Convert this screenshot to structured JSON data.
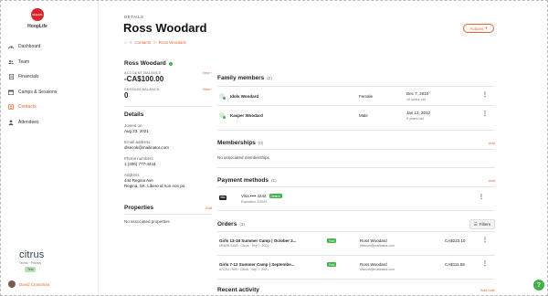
{
  "app": {
    "logo_text": "HoopLife",
    "logo_badge": "HoopLife"
  },
  "sidebar": {
    "items": [
      {
        "label": "Dashboard",
        "icon": "dashboard-icon"
      },
      {
        "label": "Team",
        "icon": "team-icon"
      },
      {
        "label": "Financials",
        "icon": "financials-icon"
      },
      {
        "label": "Camps & Sessions",
        "icon": "camps-icon"
      },
      {
        "label": "Contacts",
        "icon": "contacts-icon",
        "active": true
      },
      {
        "label": "Attendees",
        "icon": "attendees-icon"
      }
    ],
    "brand": "citrus",
    "footer_links": "Terms  ·  Privacy",
    "env_badge": "Test",
    "user_name": "David Crossman"
  },
  "header": {
    "section_label": "DETAILS",
    "title": "Ross Woodard",
    "breadcrumb": [
      "⌂",
      ">",
      "Contacts",
      ">",
      "Ross Woodard"
    ],
    "actions_label": "Actions"
  },
  "profile": {
    "name": "Ross Woodard",
    "account_balance_label": "ACCOUNT BALANCE",
    "account_balance_value": "-CA$100.00",
    "session_balance_label": "SESSION BALANCE",
    "session_balance_value": "0",
    "view_label": "View"
  },
  "details": {
    "title": "Details",
    "joined_label": "Joined on",
    "joined_value": "Aug 23, 2021",
    "email_label": "Email address",
    "email_value": "dlsecok@mailinator.com",
    "phone_label": "Phone numbers",
    "phone_value": "1 (306) 777-4444",
    "address_label": "Address",
    "address_line1": "444 Regina Ave",
    "address_line2": "Regina, SK. Libero id non non po"
  },
  "properties": {
    "title": "Properties",
    "edit_label": "Edit",
    "empty": "No associated properties"
  },
  "family": {
    "title": "Family members",
    "count": "(2)",
    "members": [
      {
        "name": "Idols Woodard",
        "gender": "Female",
        "dob": "Dec 7, 2010",
        "age": "10 years old"
      },
      {
        "name": "Kasper Woodard",
        "gender": "Male",
        "dob": "Jan 13, 2012",
        "age": "9 years old"
      }
    ]
  },
  "memberships": {
    "title": "Memberships",
    "count": "(0)",
    "add_label": "Add",
    "empty": "No associated memberships"
  },
  "payments": {
    "title": "Payment methods",
    "count": "(1)",
    "add_label": "Add",
    "card_brand": "VISA",
    "card_label": "Visa •••• 4242",
    "default_label": "Default",
    "expiry": "Expiration: 4/2024"
  },
  "orders": {
    "title": "Orders",
    "count": "(2)",
    "filters_label": "Filters",
    "items": [
      {
        "title": "Girls 13-18 Summer Camp | October 2...",
        "sub": "#R4BR-5163 · Citrus · Sep 7, 2021",
        "status": "Paid",
        "customer": "Ross Woodard",
        "email": "dlsecok@mailinator.com",
        "amount": "CA$223.10"
      },
      {
        "title": "Girls 7-12 Summer Camp | Septembe...",
        "sub": "#7C2U-7995 · Citrus · Sep 7, 2021",
        "status": "Paid",
        "customer": "Ross Woodard",
        "email": "dlsecok@mailinator.com",
        "amount": "CA$111.55"
      }
    ]
  },
  "activity": {
    "title": "Recent activity",
    "add_label": "Add note"
  },
  "colors": {
    "accent": "#e5642d",
    "success": "#43b04a",
    "brand_red": "#d7262b"
  }
}
